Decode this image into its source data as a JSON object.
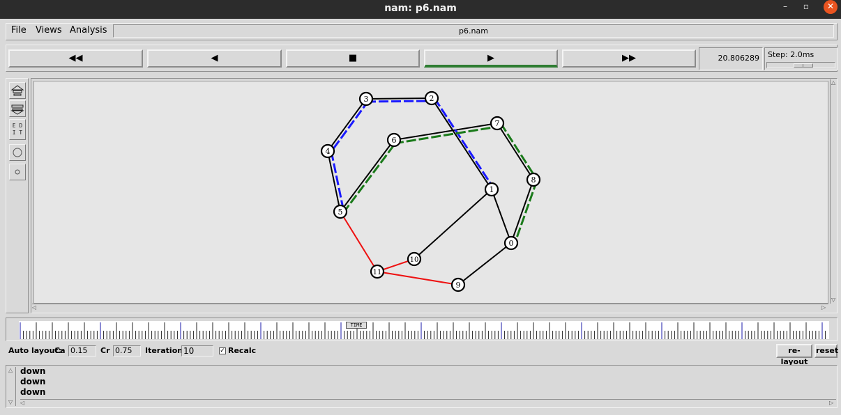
{
  "window": {
    "title": "nam: p6.nam",
    "controls": {
      "minimize": "–",
      "maximize": "▫",
      "close": "✕"
    }
  },
  "menu": {
    "file": "File",
    "views": "Views",
    "analysis": "Analysis",
    "filename": "p6.nam"
  },
  "playback": {
    "rewind_icon": "◀◀",
    "back_icon": "◀",
    "stop_icon": "■",
    "play_icon": "▶",
    "fast_forward_icon": "▶▶",
    "active": "play",
    "time": "20.806289",
    "step_label": "Step: 2.0ms"
  },
  "tools": {
    "edit_label": "E D I T"
  },
  "network": {
    "nodes": [
      "0",
      "1",
      "2",
      "3",
      "4",
      "5",
      "6",
      "7",
      "8",
      "9",
      "10",
      "11"
    ],
    "link_colors": {
      "base": "#000000",
      "blue_flow": "#1a1aff",
      "green_flow": "#1a7a1a",
      "red_link": "#ee1111"
    }
  },
  "timeline": {
    "label": "TIME"
  },
  "auto_layout": {
    "label": "Auto layout:",
    "ca_label": "Ca",
    "ca_value": "0.15",
    "cr_label": "Cr",
    "cr_value": "0.75",
    "iterations_label": "Iterations",
    "iterations_value": "10",
    "recalc_label": "Recalc",
    "recalc_checked": true,
    "relayout_button": "re-layout",
    "reset_button": "reset"
  },
  "log": {
    "lines": [
      "down",
      "down",
      "down"
    ]
  }
}
